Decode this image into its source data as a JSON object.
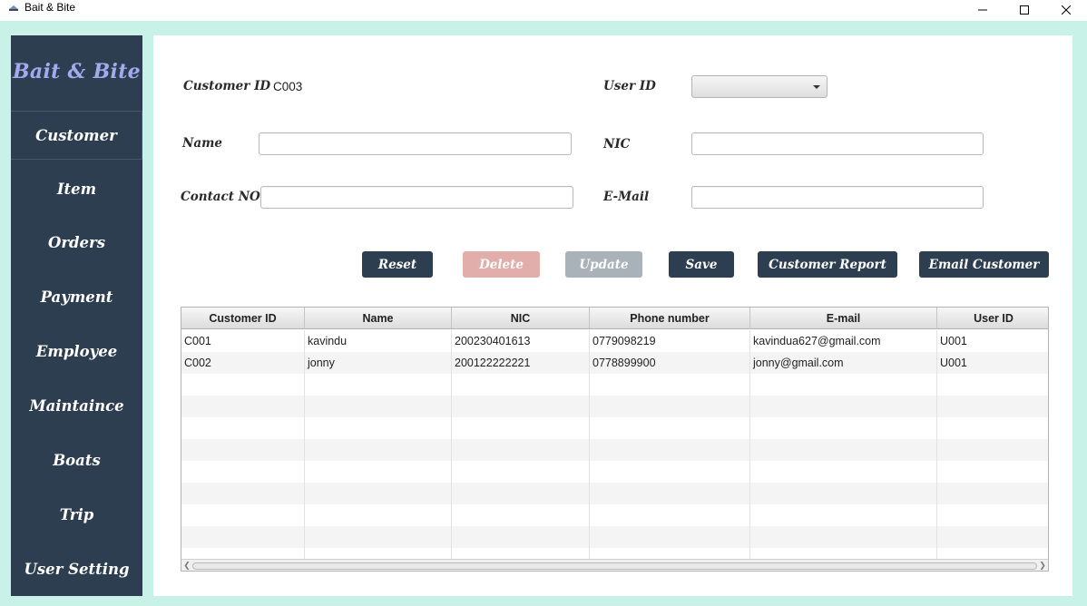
{
  "window": {
    "title": "Bait & Bite"
  },
  "sidebar": {
    "brand": "Bait & Bite",
    "items": [
      {
        "label": "Customer"
      },
      {
        "label": "Item"
      },
      {
        "label": "Orders"
      },
      {
        "label": "Payment"
      },
      {
        "label": "Employee"
      },
      {
        "label": "Maintaince"
      },
      {
        "label": "Boats"
      },
      {
        "label": "Trip"
      },
      {
        "label": "User Setting"
      }
    ]
  },
  "form": {
    "customer_id_label": "Customer ID",
    "customer_id_value": "C003",
    "user_id_label": "User ID",
    "user_id_value": "",
    "name_label": "Name",
    "name_value": "",
    "nic_label": "NIC",
    "nic_value": "",
    "contact_label": "Contact NO",
    "contact_value": "",
    "email_label": "E-Mail",
    "email_value": ""
  },
  "buttons": {
    "reset": "Reset",
    "delete": "Delete",
    "update": "Update",
    "save": "Save",
    "customer_report": "Customer Report",
    "email_customer": "Email Customer"
  },
  "colors": {
    "sidebar_bg": "#2d3e50",
    "frame_bg": "#c8f2e8",
    "brand_text": "#a5a9ee",
    "button_primary": "#2d3e50",
    "button_delete_disabled": "#e2aeab",
    "button_update_disabled": "#a9b1b9"
  },
  "table": {
    "columns": [
      "Customer ID",
      "Name",
      "NIC",
      "Phone number",
      "E-mail",
      "User ID"
    ],
    "rows": [
      [
        "C001",
        "kavindu",
        "200230401613",
        "0779098219",
        "kavindua627@gmail.com",
        "U001"
      ],
      [
        "C002",
        "jonny",
        "200122222221",
        "0778899900",
        "jonny@gmail.com",
        "U001"
      ]
    ]
  }
}
